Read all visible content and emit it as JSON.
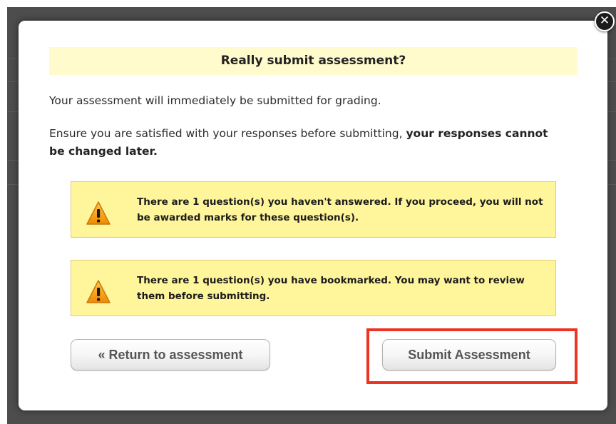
{
  "dialog": {
    "close_glyph": "✕",
    "title": "Really submit assessment?",
    "intro": "Your assessment will immediately be submitted for grading.",
    "ensure_text": "Ensure you are satisfied with your responses before submitting,",
    "ensure_bold": "your responses cannot be changed later."
  },
  "warnings": [
    {
      "icon": "warning-triangle-icon",
      "text": "There are 1 question(s) you haven't answered. If you proceed, you will not be awarded marks for these question(s)."
    },
    {
      "icon": "warning-triangle-icon",
      "text": "There are 1 question(s) you have bookmarked. You may want to review them before submitting."
    }
  ],
  "buttons": {
    "return_label": "« Return to assessment",
    "submit_label": "Submit Assessment"
  },
  "colors": {
    "title_background": "#fffbcc",
    "warning_background": "#fff59b",
    "highlight_outline": "#ee3322",
    "overlay": "#4d4d4d"
  }
}
